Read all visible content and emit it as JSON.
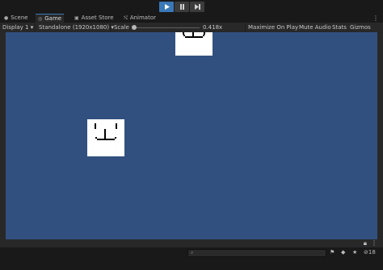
{
  "playbar": {
    "play_icon": "play-icon",
    "pause_icon": "pause-icon",
    "step_icon": "step-icon"
  },
  "tabs": [
    {
      "label": "Scene",
      "icon": "scene-icon"
    },
    {
      "label": "Game",
      "icon": "game-icon"
    },
    {
      "label": "Asset Store",
      "icon": "asset-store-icon"
    },
    {
      "label": "Animator",
      "icon": "animator-icon"
    }
  ],
  "tab_menu": "⋮",
  "toolbar": {
    "display": "Display 1",
    "resolution": "Standalone (1920x1080)",
    "scale_label": "Scale",
    "scale_value": "0.418x",
    "maximize": "Maximize On Play",
    "mute": "Mute Audio",
    "stats": "Stats",
    "gizmos": "Gizmos"
  },
  "viewport": {
    "background": "#31507f",
    "sprite_color": "#ffffff"
  },
  "console": {
    "search_placeholder": "",
    "warning_count": "18"
  }
}
